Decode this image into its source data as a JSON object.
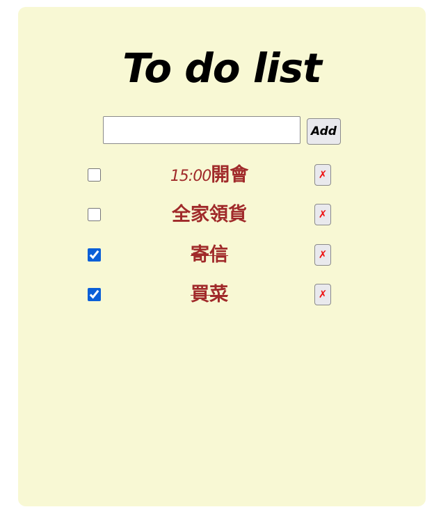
{
  "app": {
    "title": "To do list"
  },
  "form": {
    "input_value": "",
    "input_placeholder": "",
    "add_label": "Add"
  },
  "todos": [
    {
      "time": "15:00",
      "text": "開會",
      "checked": false
    },
    {
      "time": "",
      "text": "全家領貨",
      "checked": false
    },
    {
      "time": "",
      "text": "寄信",
      "checked": true
    },
    {
      "time": "",
      "text": "買菜",
      "checked": true
    }
  ],
  "delete_label": "✗",
  "colors": {
    "card_background": "#f8f8d4",
    "item_text": "#a02a2a",
    "delete_icon": "#ee1111",
    "checkbox_accent": "#0b5fd8"
  }
}
